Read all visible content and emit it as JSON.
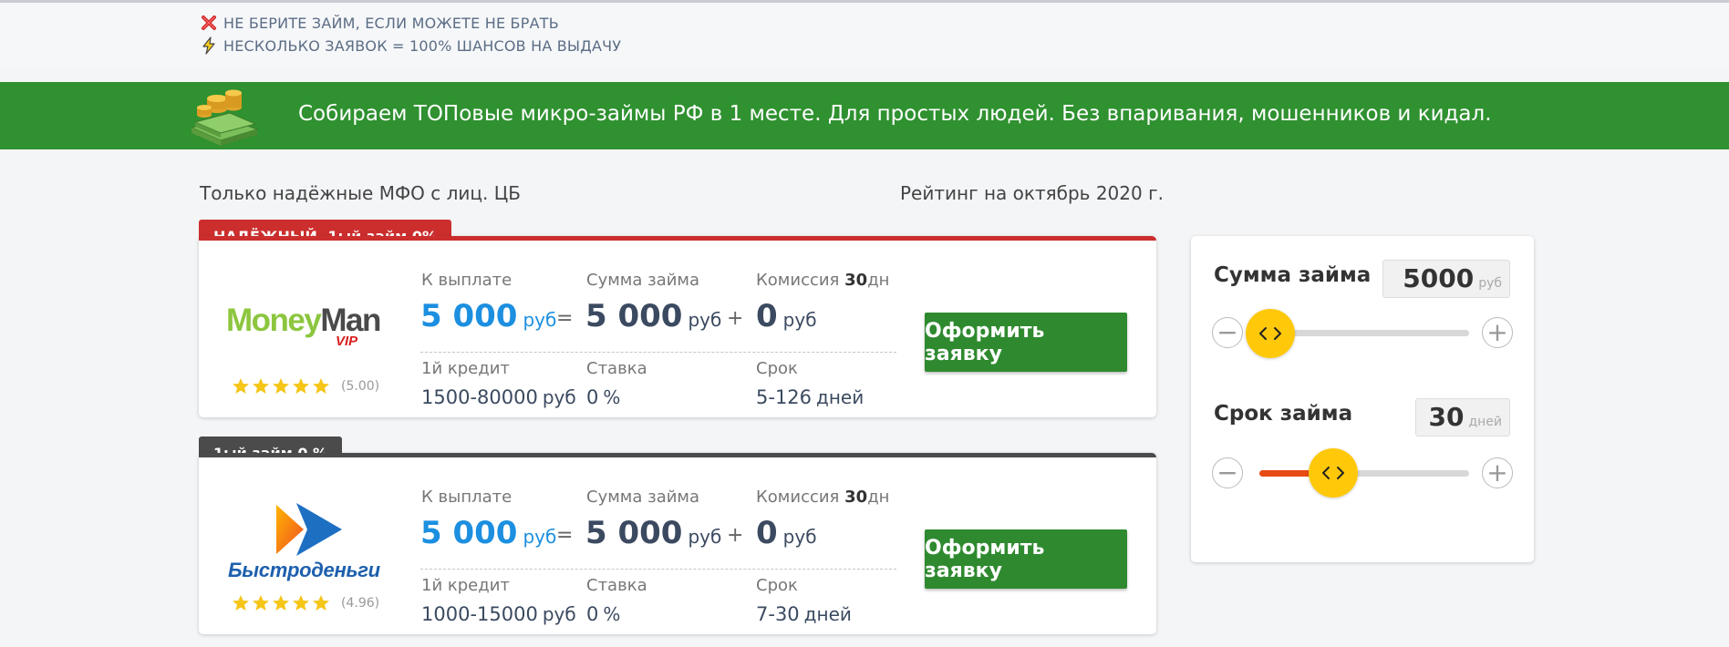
{
  "notices": [
    {
      "icon": "red-x-icon",
      "text": "НЕ БЕРИТЕ ЗАЙМ, ЕСЛИ МОЖЕТЕ НЕ БРАТЬ"
    },
    {
      "icon": "lightning-icon",
      "text": "НЕСКОЛЬКО ЗАЯВОК = 100% ШАНСОВ НА ВЫДАЧУ"
    }
  ],
  "banner": {
    "icon": "money-stack-icon",
    "text": "Собираем ТОПовые микро-займы РФ в 1 месте. Для простых людей. Без впаривания, мошенников и кидал."
  },
  "subheader": {
    "left": "Только надёжные МФО с лиц. ЦБ",
    "right": "Рейтинг на октябрь 2020 г."
  },
  "offers": [
    {
      "tag": "НАДЁЖНЫЙ, 1ый займ 0%",
      "logo": {
        "part1": "Money",
        "part2": "Man",
        "sub": "VIP"
      },
      "stars": 5,
      "rating": "(5.00)",
      "labels": {
        "payout": "К выплате",
        "amount": "Сумма займа",
        "commission": "Комиссия",
        "commission_days": "30",
        "commission_unit": "дн"
      },
      "payout": "5 000",
      "amount": "5 000",
      "commission": "0",
      "currency": "руб",
      "first_credit_label": "1й кредит",
      "first_credit": "1500-80000",
      "rate_label": "Ставка",
      "rate": "0",
      "rate_unit": "%",
      "term_label": "Срок",
      "term": "5-126",
      "term_unit": "дней",
      "button": "Оформить заявку"
    },
    {
      "tag": "1ый займ 0 %",
      "logo": {
        "text": "Быстроденьги"
      },
      "stars": 5,
      "rating": "(4.96)",
      "labels": {
        "payout": "К выплате",
        "amount": "Сумма займа",
        "commission": "Комиссия",
        "commission_days": "30",
        "commission_unit": "дн"
      },
      "payout": "5 000",
      "amount": "5 000",
      "commission": "0",
      "currency": "руб",
      "first_credit_label": "1й кредит",
      "first_credit": "1000-15000",
      "rate_label": "Ставка",
      "rate": "0",
      "rate_unit": "%",
      "term_label": "Срок",
      "term": "7-30",
      "term_unit": "дней",
      "button": "Оформить заявку"
    }
  ],
  "calculator": {
    "amount": {
      "title": "Сумма займа",
      "value": "5000",
      "unit": "руб",
      "minus": "−",
      "plus": "+",
      "level": 0.05
    },
    "term": {
      "title": "Срок займа",
      "value": "30",
      "unit": "дней",
      "minus": "−",
      "plus": "+",
      "level": 0.35
    }
  },
  "colors": {
    "banner": "#2f9130",
    "tag_red": "#cc2e2e",
    "tag_dark": "#4b4b4b",
    "accent_blue": "#1c8fe0",
    "button": "#2f8a2f",
    "slider_fill": "#e84a14",
    "slider_knob": "#ffc90a"
  }
}
